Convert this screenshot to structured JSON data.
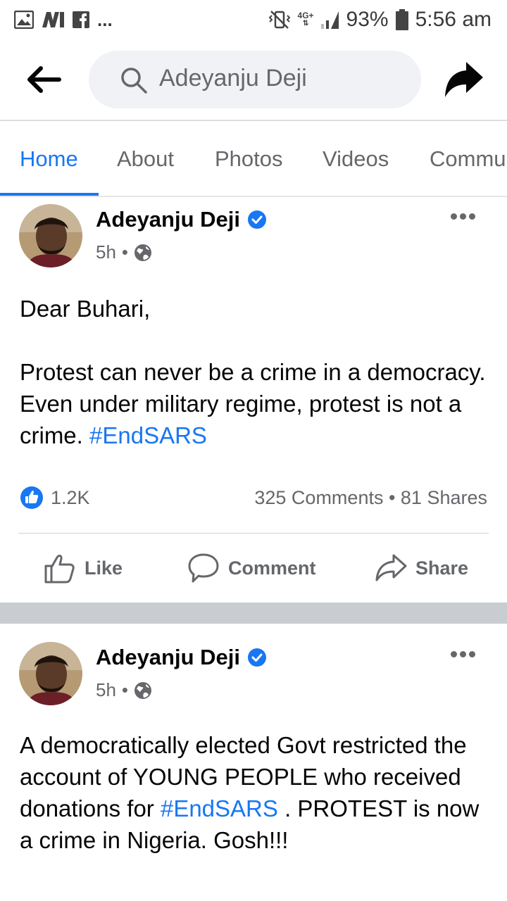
{
  "status_bar": {
    "battery": "93%",
    "time": "5:56 am",
    "network": "4G+"
  },
  "search": {
    "value": "Adeyanju Deji"
  },
  "tabs": [
    "Home",
    "About",
    "Photos",
    "Videos",
    "Commu"
  ],
  "active_tab": "Home",
  "posts": [
    {
      "author": "Adeyanju Deji",
      "time": "5h",
      "paragraph1": "Dear Buhari,",
      "paragraph2_text": "Protest can never be a crime in a democracy. Even under military regime, protest is not a crime. ",
      "paragraph2_hashtag": "#EndSARS",
      "reactions": "1.2K",
      "comments_shares": "325 Comments • 81 Shares",
      "actions": {
        "like": "Like",
        "comment": "Comment",
        "share": "Share"
      }
    },
    {
      "author": "Adeyanju Deji",
      "time": "5h",
      "text_before": "A democratically elected Govt restricted the account of YOUNG PEOPLE who received donations for ",
      "hashtag": "#EndSARS",
      "text_after": " . PROTEST is now a crime in Nigeria. Gosh!!!"
    }
  ],
  "colors": {
    "accent": "#1877f2",
    "muted_text": "#65676b",
    "separator": "#c9ccd1"
  }
}
